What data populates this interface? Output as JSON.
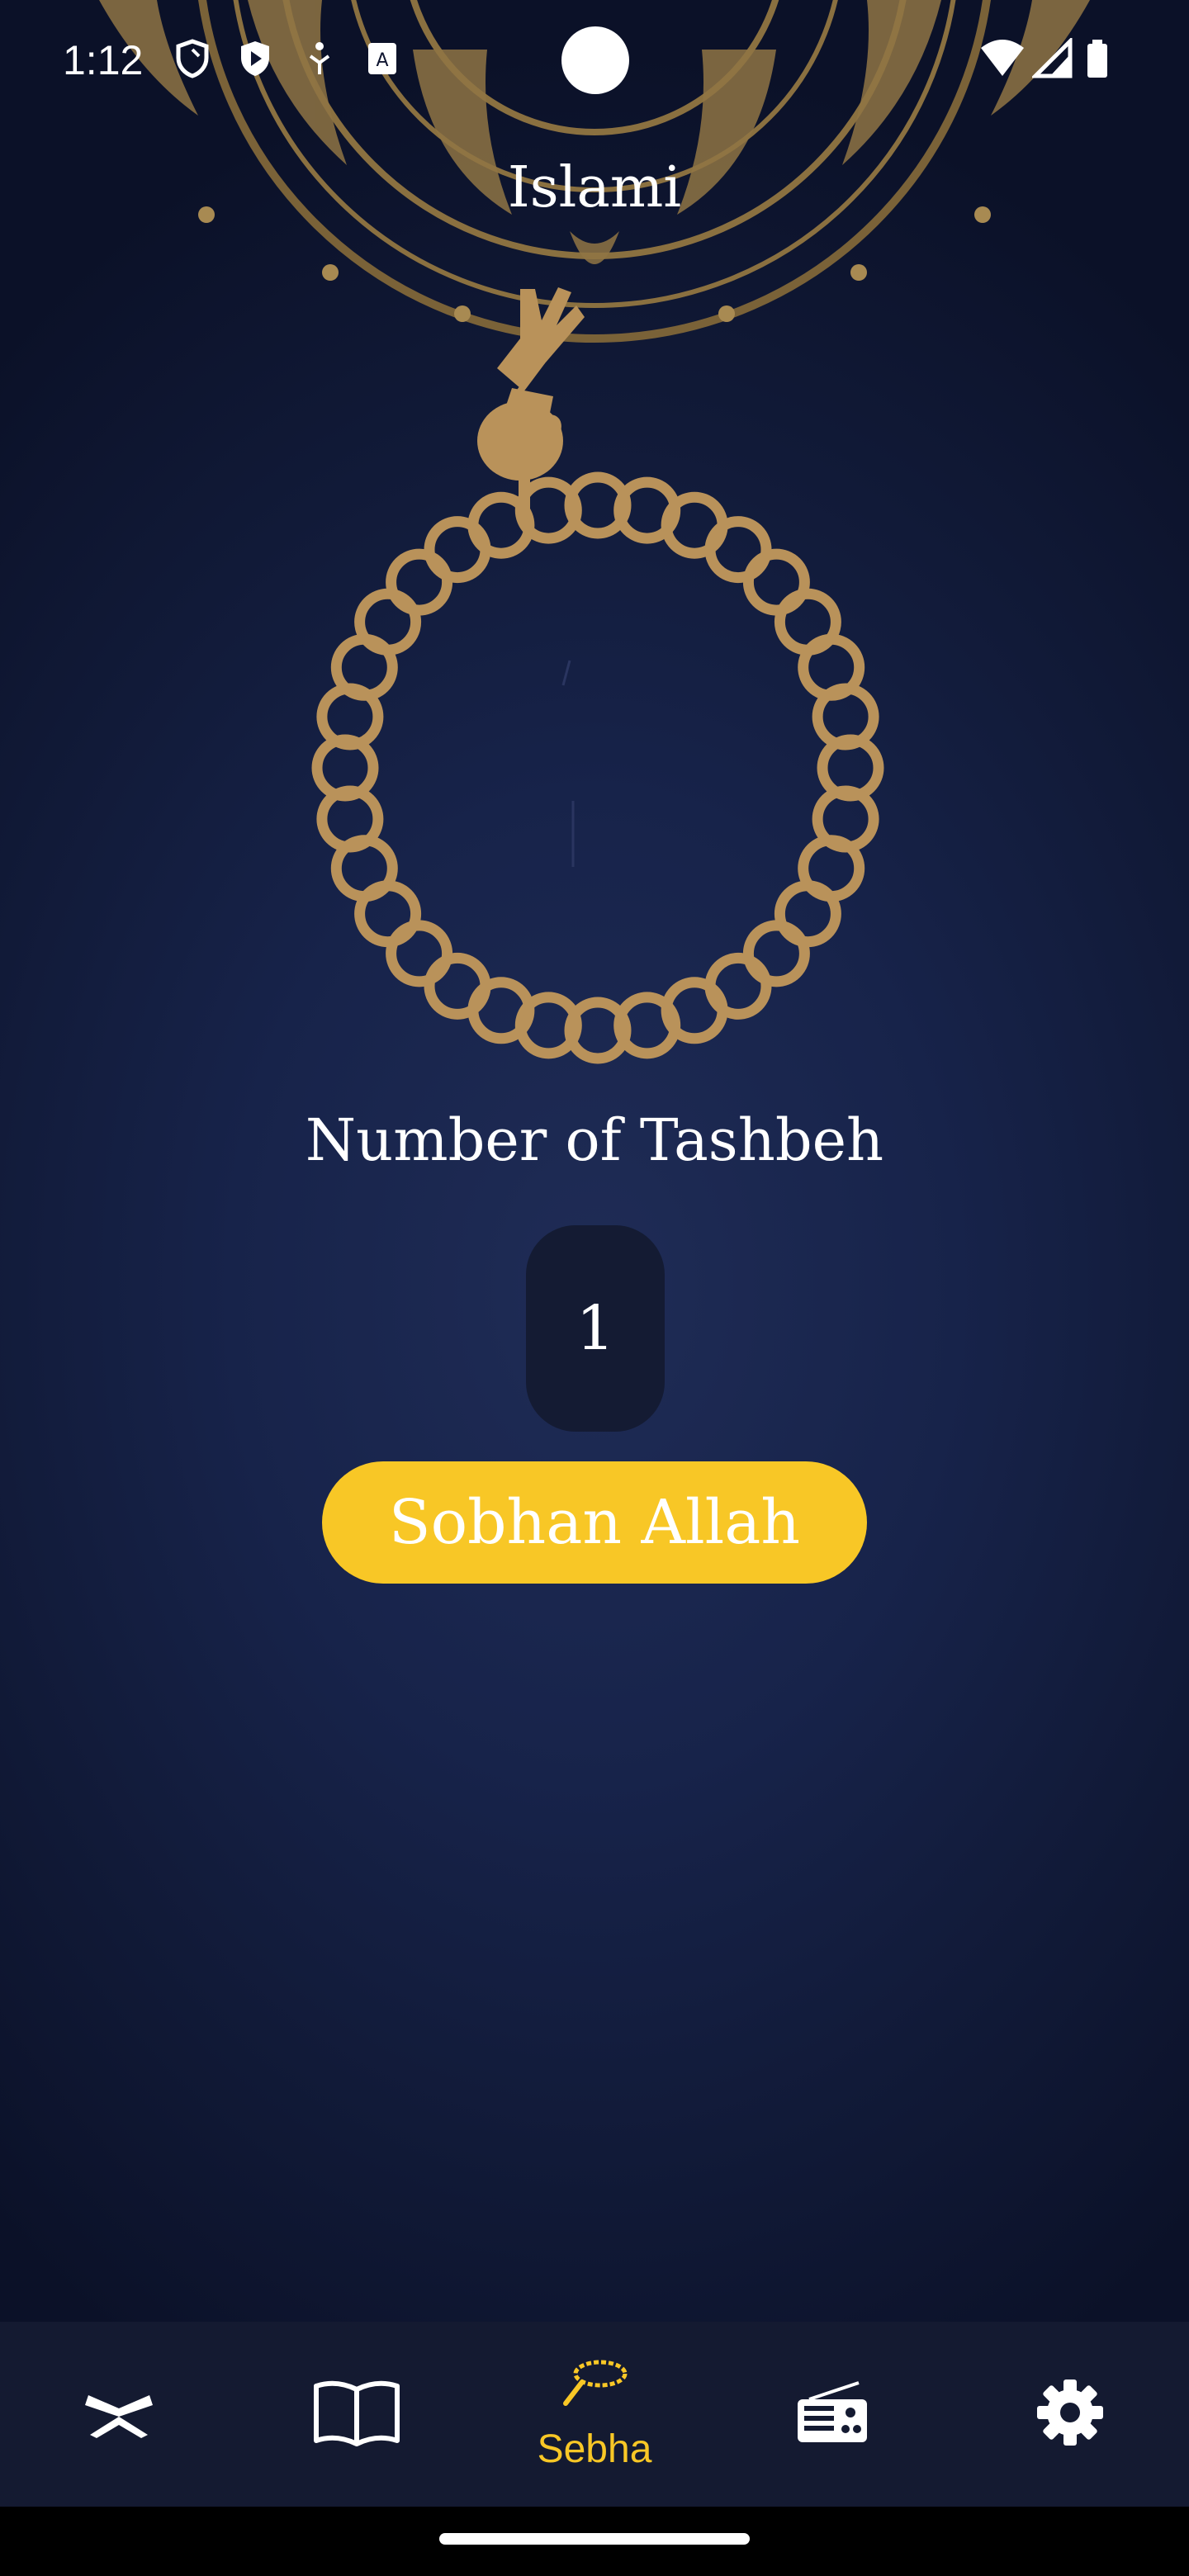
{
  "status_bar": {
    "time": "1:12"
  },
  "header": {
    "title": "Islami"
  },
  "sebha": {
    "count_label": "Number of Tashbeh",
    "count": "1",
    "zikr": "Sobhan Allah"
  },
  "bottom_nav": {
    "items": [
      {
        "icon": "quran-icon",
        "label": ""
      },
      {
        "icon": "hadith-book-icon",
        "label": ""
      },
      {
        "icon": "sebha-icon",
        "label": "Sebha",
        "active": true
      },
      {
        "icon": "radio-icon",
        "label": ""
      },
      {
        "icon": "settings-icon",
        "label": ""
      }
    ]
  },
  "colors": {
    "accent": "#f8c726",
    "gold": "#b5935a",
    "background": "#17234a",
    "nav_background": "#141a31"
  }
}
